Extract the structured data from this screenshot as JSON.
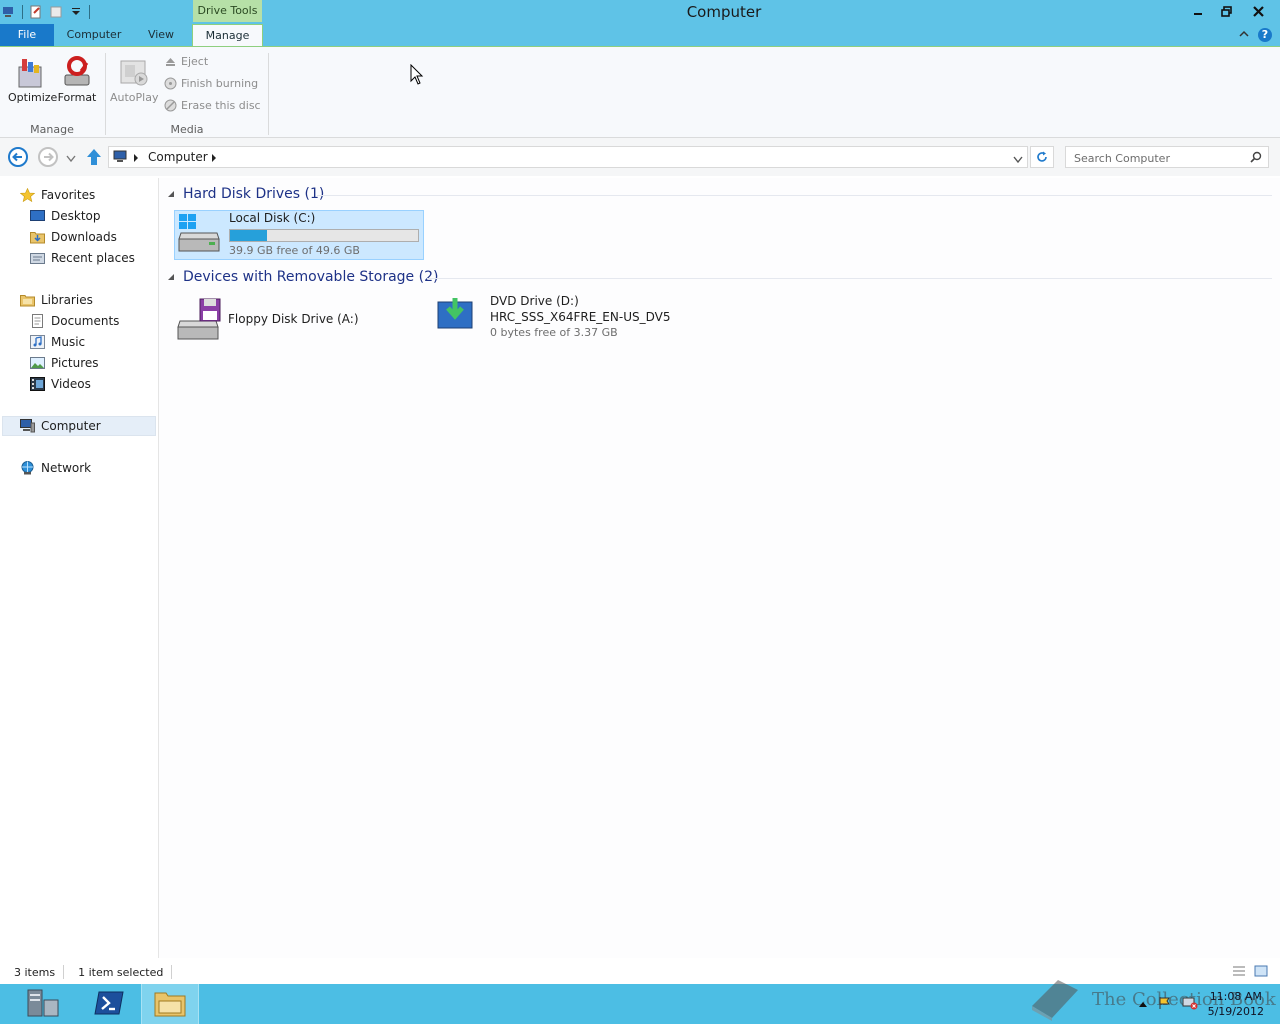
{
  "window": {
    "title": "Computer",
    "context_tab_group": "Drive Tools"
  },
  "ribbon_tabs": [
    {
      "label": "File"
    },
    {
      "label": "Computer"
    },
    {
      "label": "View"
    },
    {
      "label": "Manage"
    }
  ],
  "ribbon": {
    "manage_group": {
      "label": "Manage",
      "optimize": "Optimize",
      "format": "Format"
    },
    "media_group": {
      "label": "Media",
      "autoplay": "AutoPlay",
      "eject": "Eject",
      "finish_burning": "Finish burning",
      "erase_disc": "Erase this disc"
    }
  },
  "address": {
    "crumb": "Computer",
    "search_placeholder": "Search Computer"
  },
  "nav": {
    "favorites": "Favorites",
    "desktop": "Desktop",
    "downloads": "Downloads",
    "recent_places": "Recent places",
    "libraries": "Libraries",
    "documents": "Documents",
    "music": "Music",
    "pictures": "Pictures",
    "videos": "Videos",
    "computer": "Computer",
    "network": "Network"
  },
  "content": {
    "hard_disk_header": "Hard Disk Drives (1)",
    "removable_header": "Devices with Removable Storage (2)",
    "local_disk": {
      "name": "Local Disk (C:)",
      "space": "39.9 GB free of 49.6 GB",
      "used_fraction": 0.196
    },
    "floppy": {
      "name": "Floppy Disk Drive (A:)"
    },
    "dvd": {
      "name": "DVD Drive (D:)",
      "label": "HRC_SSS_X64FRE_EN-US_DV5",
      "space": "0 bytes free of 3.37 GB"
    }
  },
  "status": {
    "items": "3 items",
    "selected": "1 item selected"
  },
  "taskbar": {
    "time": "11:08 AM",
    "date": "5/19/2012"
  },
  "watermark": "The Collection Book",
  "colors": {
    "titlebar": "#5fc3e7",
    "file_tab": "#1979ca",
    "context_tab": "#b6e0a7",
    "selection": "#cce8ff",
    "taskbar": "#4cbee4"
  }
}
